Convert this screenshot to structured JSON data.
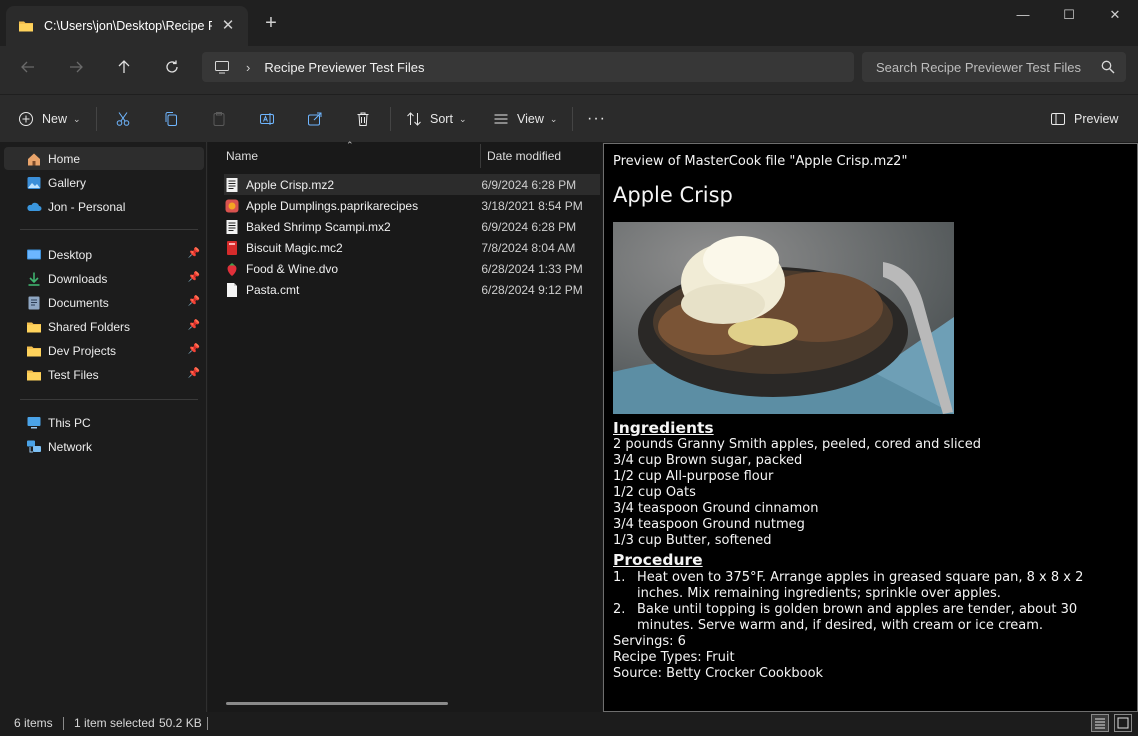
{
  "window": {
    "tab_title": "C:\\Users\\jon\\Desktop\\Recipe Previewer Test Files",
    "new_tab": "+",
    "controls": {
      "minimize": "—",
      "maximize": "☐",
      "close": "✕"
    }
  },
  "address": {
    "path": "Recipe Previewer Test Files",
    "search_placeholder": "Search Recipe Previewer Test Files"
  },
  "commands": {
    "new": "New",
    "sort": "Sort",
    "view": "View",
    "more": "···",
    "preview": "Preview"
  },
  "sidebar": {
    "items": [
      {
        "label": "Home",
        "icon": "home-icon",
        "active": true
      },
      {
        "label": "Gallery",
        "icon": "gallery-icon"
      },
      {
        "label": "Jon - Personal",
        "icon": "onedrive-icon"
      },
      {
        "label": "Desktop",
        "icon": "desktop-icon",
        "pinned": true
      },
      {
        "label": "Downloads",
        "icon": "download-icon",
        "pinned": true
      },
      {
        "label": "Documents",
        "icon": "documents-icon",
        "pinned": true
      },
      {
        "label": "Shared Folders",
        "icon": "folder-icon",
        "pinned": true
      },
      {
        "label": "Dev Projects",
        "icon": "folder-icon",
        "pinned": true
      },
      {
        "label": "Test Files",
        "icon": "folder-icon",
        "pinned": true
      },
      {
        "label": "This PC",
        "icon": "computer-icon"
      },
      {
        "label": "Network",
        "icon": "network-icon"
      }
    ]
  },
  "filelist": {
    "columns": {
      "name": "Name",
      "date": "Date modified"
    },
    "files": [
      {
        "name": "Apple Crisp.mz2",
        "date": "6/9/2024 6:28 PM",
        "icon": "mastercook-file-icon",
        "selected": true
      },
      {
        "name": "Apple Dumplings.paprikarecipes",
        "date": "3/18/2021 8:54 PM",
        "icon": "paprika-file-icon"
      },
      {
        "name": "Baked Shrimp Scampi.mx2",
        "date": "6/9/2024 6:28 PM",
        "icon": "mastercook-file-icon"
      },
      {
        "name": "Biscuit Magic.mc2",
        "date": "7/8/2024 8:04 AM",
        "icon": "red-document-icon"
      },
      {
        "name": "Food & Wine.dvo",
        "date": "6/28/2024 1:33 PM",
        "icon": "strawberry-icon"
      },
      {
        "name": "Pasta.cmt",
        "date": "6/28/2024 9:12 PM",
        "icon": "blank-file-icon"
      }
    ]
  },
  "preview": {
    "caption": "Preview of MasterCook file \"Apple Crisp.mz2\"",
    "title": "Apple Crisp",
    "image_alt": "Apple crisp with ice cream in a bowl",
    "ingredients_heading": "Ingredients",
    "ingredients": [
      "2 pounds Granny Smith apples, peeled, cored and sliced",
      "3/4 cup Brown sugar, packed",
      "1/2 cup All-purpose flour",
      "1/2 cup Oats",
      "3/4 teaspoon Ground cinnamon",
      "3/4 teaspoon Ground nutmeg",
      "1/3 cup Butter, softened"
    ],
    "procedure_heading": "Procedure",
    "steps": [
      {
        "num": "1.",
        "text": "Heat oven to 375°F. Arrange apples in greased square pan, 8 x 8 x 2 inches. Mix remaining ingredients; sprinkle over apples."
      },
      {
        "num": "2.",
        "text": "Bake until topping is golden brown and apples are tender, about 30 minutes. Serve warm and, if desired, with cream or ice cream."
      }
    ],
    "servings": "Servings: 6",
    "recipe_types": "Recipe Types: Fruit",
    "source": "Source: Betty Crocker Cookbook"
  },
  "status": {
    "count": "6 items",
    "selection": "1 item selected",
    "size": "50.2 KB"
  }
}
